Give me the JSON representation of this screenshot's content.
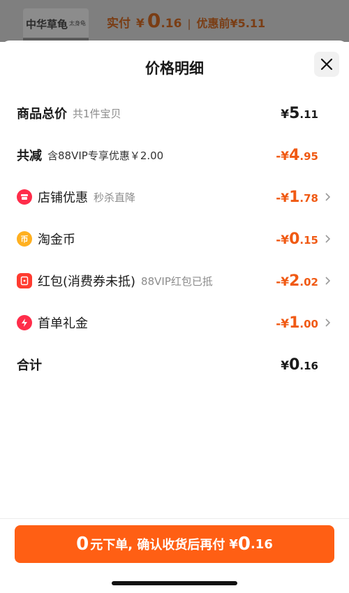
{
  "background": {
    "thumbnail_text": "中华草龟",
    "thumbnail_subtext": "太身龟",
    "paid_label": "实付",
    "currency": "¥",
    "paid_int": "0",
    "paid_dec": ".16",
    "separator": "|",
    "original_price": "优惠前¥5.11"
  },
  "sheet": {
    "title": "价格明细",
    "close_icon": "close-icon"
  },
  "rows": {
    "total": {
      "label": "商品总价",
      "sub": "共1件宝贝",
      "amount_prefix": "¥",
      "amount_int": "5",
      "amount_dec": ".11"
    },
    "reduce": {
      "label": "共减",
      "sub": "含88VIP专享优惠￥2.00",
      "amount_prefix": "-¥",
      "amount_int": "4",
      "amount_dec": ".95"
    },
    "store": {
      "icon": "store-icon",
      "label": "店铺优惠",
      "sub": "秒杀直降",
      "amount_prefix": "-¥",
      "amount_int": "1",
      "amount_dec": ".78"
    },
    "coin": {
      "icon": "coin-icon",
      "label": "淘金币",
      "sub": "",
      "amount_prefix": "-¥",
      "amount_int": "0",
      "amount_dec": ".15"
    },
    "redpacket": {
      "icon": "red-packet-icon",
      "label": "红包(消费券未抵)",
      "sub": "88VIP红包已抵",
      "amount_prefix": "-¥",
      "amount_int": "2",
      "amount_dec": ".02"
    },
    "gift": {
      "icon": "lightning-icon",
      "label": "首单礼金",
      "sub": "",
      "amount_prefix": "-¥",
      "amount_int": "1",
      "amount_dec": ".00"
    },
    "sum": {
      "label": "合计",
      "amount_prefix": "¥",
      "amount_int": "0",
      "amount_dec": ".16"
    }
  },
  "cta": {
    "big": "0",
    "text": "元下单, 确认收货后再付",
    "yen": "¥",
    "int": "0",
    "dec": ".16"
  },
  "colors": {
    "accent": "#ff5f14",
    "discount": "#f05a14",
    "store_icon": "#ff2d4a",
    "coin_icon": "#ffb020",
    "redpacket_icon": "#ff3b30",
    "gift_icon": "#ff2d4a"
  }
}
